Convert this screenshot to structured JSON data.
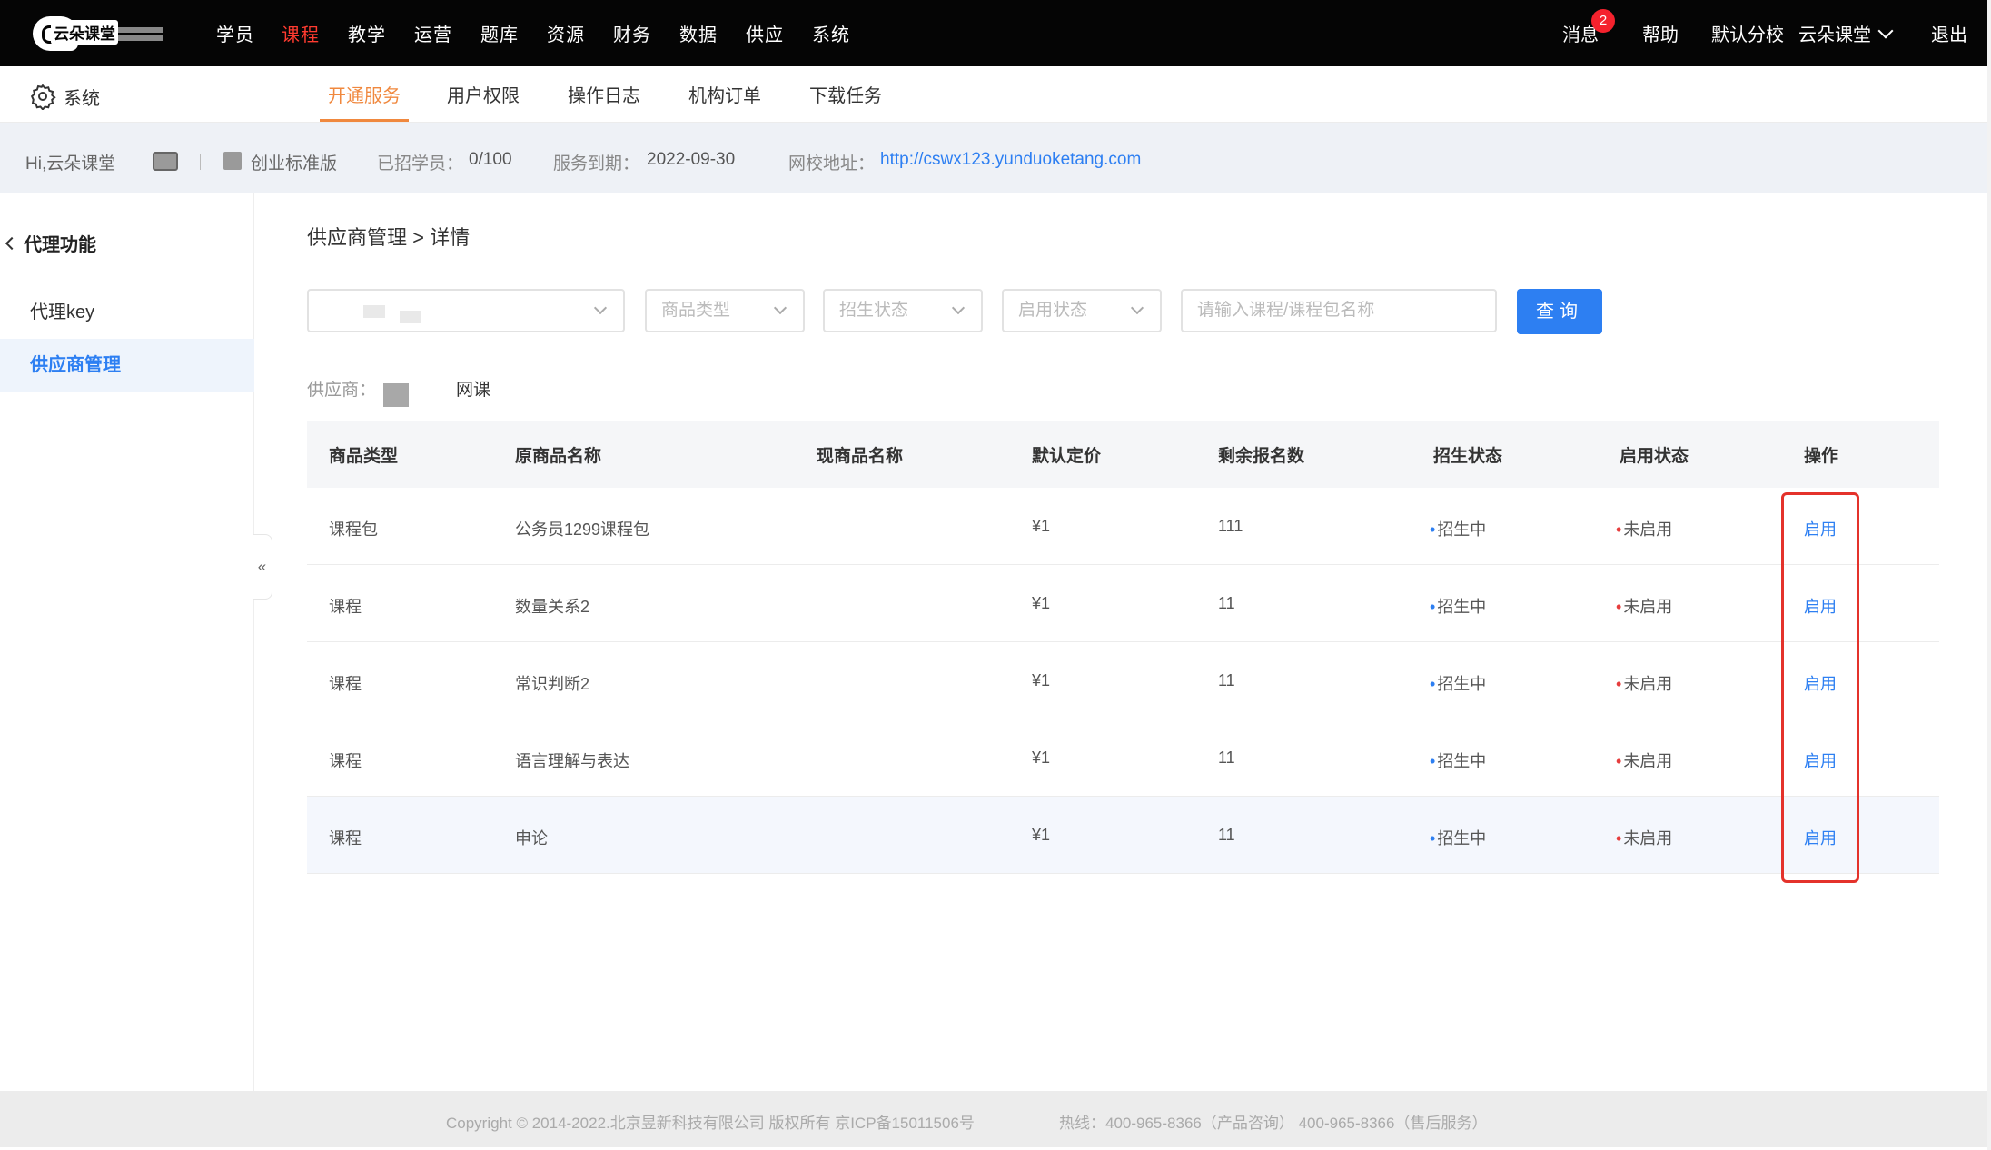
{
  "app": {
    "logo_text": "云朵课堂"
  },
  "topnav": {
    "items": [
      {
        "label": "学员",
        "active": false
      },
      {
        "label": "课程",
        "active": true
      },
      {
        "label": "教学",
        "active": false
      },
      {
        "label": "运营",
        "active": false
      },
      {
        "label": "题库",
        "active": false
      },
      {
        "label": "资源",
        "active": false
      },
      {
        "label": "财务",
        "active": false
      },
      {
        "label": "数据",
        "active": false
      },
      {
        "label": "供应",
        "active": false
      },
      {
        "label": "系统",
        "active": false
      }
    ],
    "messages_label": "消息",
    "messages_count": "2",
    "help_label": "帮助",
    "branch_label": "默认分校",
    "account_label": "云朵课堂",
    "logout_label": "退出"
  },
  "subnav": {
    "section_label": "系统",
    "tabs": [
      {
        "label": "开通服务",
        "active": true
      },
      {
        "label": "用户权限",
        "active": false
      },
      {
        "label": "操作日志",
        "active": false
      },
      {
        "label": "机构订单",
        "active": false
      },
      {
        "label": "下载任务",
        "active": false
      }
    ]
  },
  "infobar": {
    "greeting": "Hi,云朵课堂",
    "edition": "创业标准版",
    "students_label": "已招学员：",
    "students_value": "0/100",
    "expiry_label": "服务到期：",
    "expiry_value": "2022-09-30",
    "site_label": "网校地址：",
    "site_url": "http://cswx123.yunduoketang.com"
  },
  "sidebar": {
    "title": "代理功能",
    "items": [
      {
        "label": "代理key",
        "active": false
      },
      {
        "label": "供应商管理",
        "active": true
      }
    ],
    "collapse_glyph": "«"
  },
  "main": {
    "breadcrumb": "供应商管理 > 详情",
    "filters": {
      "supplier_select_value": "",
      "product_type_placeholder": "商品类型",
      "enroll_status_placeholder": "招生状态",
      "enable_status_placeholder": "启用状态",
      "search_placeholder": "请输入课程/课程包名称",
      "query_button": "查询"
    },
    "supplier_label": "供应商：",
    "supplier_value_suffix": "网课",
    "table": {
      "columns": [
        "商品类型",
        "原商品名称",
        "现商品名称",
        "默认定价",
        "剩余报名数",
        "招生状态",
        "启用状态",
        "操作"
      ],
      "rows": [
        {
          "type": "课程包",
          "orig_name": "公务员1299课程包",
          "cur_name": "",
          "price": "¥1",
          "remaining": "111",
          "enroll_status": "招生中",
          "enable_status": "未启用",
          "action": "启用"
        },
        {
          "type": "课程",
          "orig_name": "数量关系2",
          "cur_name": "",
          "price": "¥1",
          "remaining": "11",
          "enroll_status": "招生中",
          "enable_status": "未启用",
          "action": "启用"
        },
        {
          "type": "课程",
          "orig_name": "常识判断2",
          "cur_name": "",
          "price": "¥1",
          "remaining": "11",
          "enroll_status": "招生中",
          "enable_status": "未启用",
          "action": "启用"
        },
        {
          "type": "课程",
          "orig_name": "语言理解与表达",
          "cur_name": "",
          "price": "¥1",
          "remaining": "11",
          "enroll_status": "招生中",
          "enable_status": "未启用",
          "action": "启用"
        },
        {
          "type": "课程",
          "orig_name": "申论",
          "cur_name": "",
          "price": "¥1",
          "remaining": "11",
          "enroll_status": "招生中",
          "enable_status": "未启用",
          "action": "启用"
        }
      ]
    }
  },
  "footer": {
    "copyright": "Copyright © 2014-2022.北京昱新科技有限公司 版权所有 京ICP备15011506号",
    "hotline": "热线：400-965-8366（产品咨询） 400-965-8366（售后服务）"
  },
  "colors": {
    "accent_blue": "#2d7ff2",
    "nav_active_red": "#ff3b30",
    "subtab_orange": "#f0883e",
    "status_red": "#e63d3d",
    "highlight_box": "#e4322b"
  }
}
